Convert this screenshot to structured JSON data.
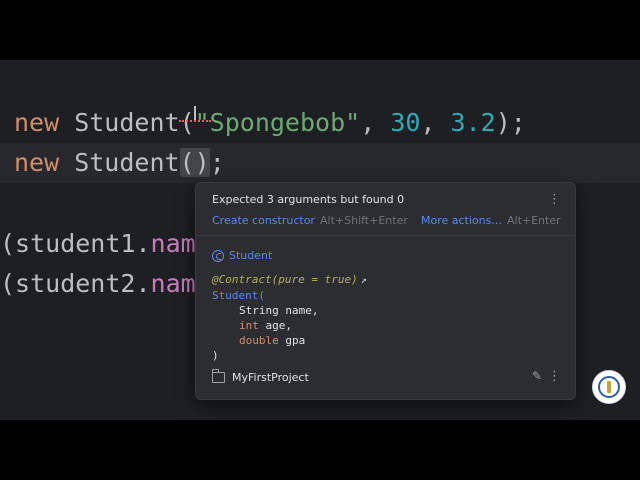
{
  "code": {
    "line1": {
      "kw": "new",
      "cls": " Student(",
      "str": "\"Spongebob\"",
      "sep1": ", ",
      "num1": "30",
      "sep2": ", ",
      "num2": "3.2",
      "end": ");"
    },
    "line2": {
      "kw": "new",
      "cls": " Student",
      "paren": "()",
      "end": ";"
    },
    "line3": {
      "pre": "(student1.",
      "field": "nam"
    },
    "line4": {
      "pre": "(student2.",
      "field": "nam"
    }
  },
  "popup": {
    "error": "Expected 3 arguments but found 0",
    "action1": "Create constructor",
    "shortcut1": "Alt+Shift+Enter",
    "action2": "More actions...",
    "shortcut2": "Alt+Enter",
    "doc_class": "Student",
    "annotation": "@Contract(pure = true)",
    "signature": "Student(",
    "params": [
      {
        "type": "String",
        "name": " name,"
      },
      {
        "type": "int",
        "name": " age,"
      },
      {
        "type": "double",
        "name": " gpa"
      }
    ],
    "close_paren": ")",
    "project": "MyFirstProject"
  },
  "icons": {
    "kebab": "more-vertical-icon",
    "pencil": "edit-icon",
    "folder": "folder-icon",
    "class": "class-icon",
    "external": "external-link-icon"
  },
  "colors": {
    "editor_bg": "#1e1f22",
    "keyword": "#cf8e6d",
    "string": "#6aab73",
    "number": "#2aacb8",
    "field": "#c77dbb",
    "link": "#548af7",
    "error": "#f75464"
  }
}
